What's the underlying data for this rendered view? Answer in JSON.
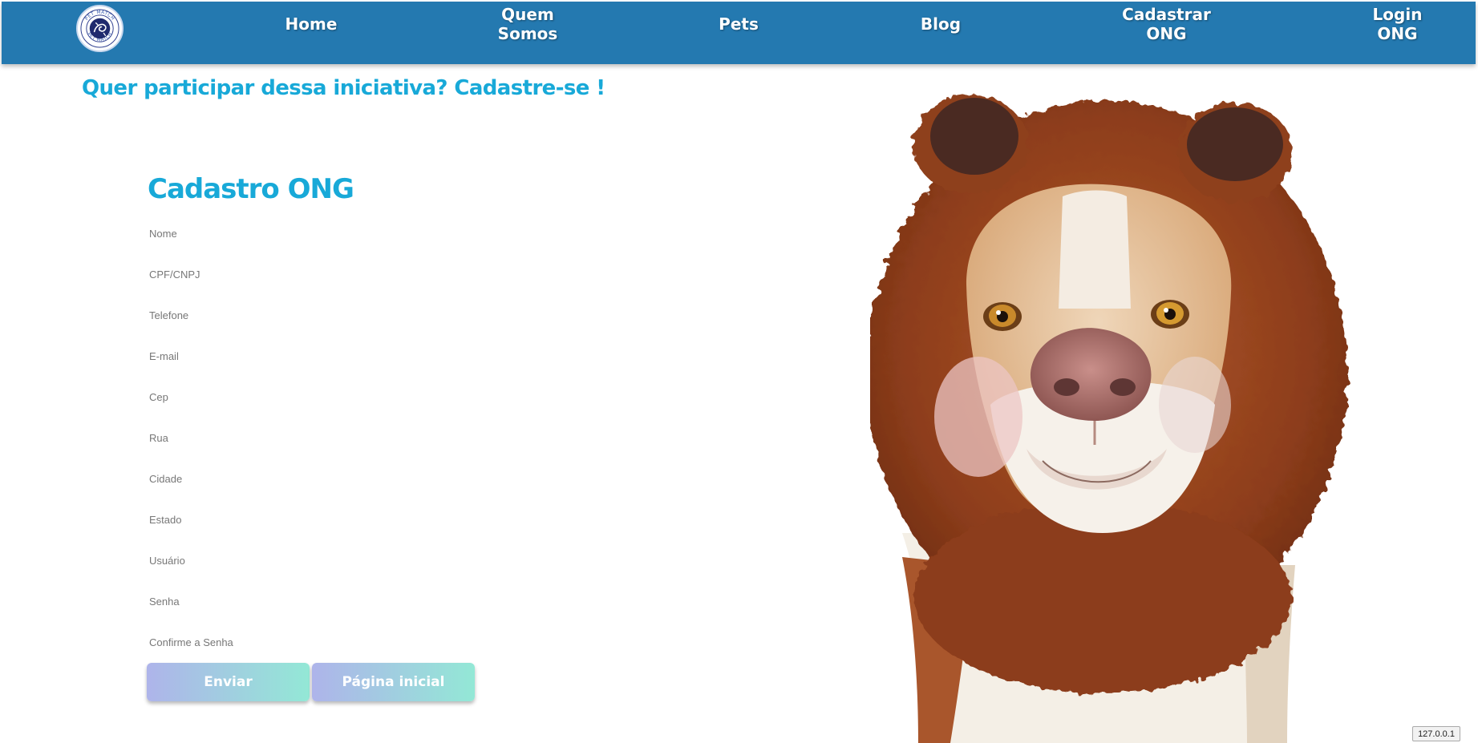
{
  "nav": {
    "logo_text": "PET MATCH",
    "items": [
      {
        "label_lines": [
          "Home"
        ]
      },
      {
        "label_lines": [
          "Quem",
          "Somos"
        ]
      },
      {
        "label_lines": [
          "Pets"
        ]
      },
      {
        "label_lines": [
          "Blog"
        ]
      },
      {
        "label_lines": [
          "Cadastrar",
          "ONG"
        ]
      },
      {
        "label_lines": [
          "Login",
          "ONG"
        ]
      }
    ]
  },
  "headline": "Quer participar dessa iniciativa? Cadastre-se !",
  "form": {
    "title": "Cadastro ONG",
    "fields": [
      {
        "placeholder": "Nome",
        "value": ""
      },
      {
        "placeholder": "CPF/CNPJ",
        "value": ""
      },
      {
        "placeholder": "Telefone",
        "value": ""
      },
      {
        "placeholder": "E-mail",
        "value": ""
      },
      {
        "placeholder": "Cep",
        "value": ""
      },
      {
        "placeholder": "Rua",
        "value": ""
      },
      {
        "placeholder": "Cidade",
        "value": ""
      },
      {
        "placeholder": "Estado",
        "value": ""
      },
      {
        "placeholder": "Usuário",
        "value": ""
      },
      {
        "placeholder": "Senha",
        "value": ""
      },
      {
        "placeholder": "Confirme a Senha",
        "value": ""
      }
    ],
    "submit_label": "Enviar",
    "home_label": "Página inicial"
  },
  "image": {
    "icon": "dog-in-bear-hat-photo"
  },
  "status": {
    "host": "127.0.0.1"
  },
  "colors": {
    "navbar": "#2479b0",
    "title": "#18a9d8",
    "button_gradient_start": "#aeb4ea",
    "button_gradient_end": "#93e8d6",
    "text_white": "#ffffff",
    "placeholder": "#777777"
  }
}
